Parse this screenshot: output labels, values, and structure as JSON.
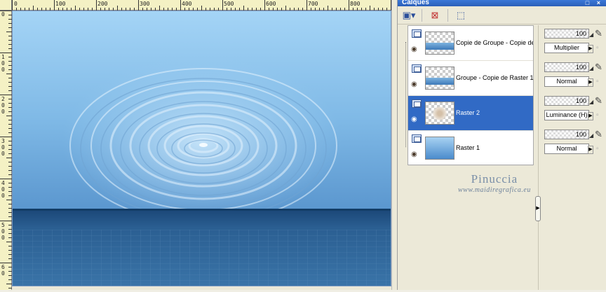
{
  "rulers": {
    "top_labels": [
      "0",
      "100",
      "200",
      "300",
      "400",
      "500",
      "600",
      "700",
      "800"
    ],
    "left_labels": [
      "0",
      "1 0 0",
      "2 0 0",
      "3 0 0",
      "4 0 0",
      "5 0 0",
      "6 0"
    ]
  },
  "panel": {
    "title": "Calques",
    "window_controls": "□ ×"
  },
  "toolbar": {
    "new_layer_icon": "new-layer-icon",
    "delete_layer_icon": "delete-layer-icon",
    "mask_icon": "mask-icon"
  },
  "layers": [
    {
      "name": "Copie de Groupe - Copie de",
      "opacity": "100",
      "blend": "Multiplier",
      "thumb": "band",
      "selected": false
    },
    {
      "name": "Groupe - Copie de Raster 1",
      "opacity": "100",
      "blend": "Normal",
      "thumb": "band",
      "selected": false
    },
    {
      "name": "Raster 2",
      "opacity": "100",
      "blend": "Luminance (H)",
      "thumb": "blob",
      "selected": true
    },
    {
      "name": "Raster 1",
      "opacity": "100",
      "blend": "Normal",
      "thumb": "solid",
      "selected": false
    }
  ],
  "watermark": {
    "name": "Pinuccia",
    "url": "www.maidiregrafica.eu"
  },
  "colors": {
    "selection": "#316ac5",
    "sky_top": "#9fd0f5",
    "sea_dark": "#1d4a78"
  }
}
